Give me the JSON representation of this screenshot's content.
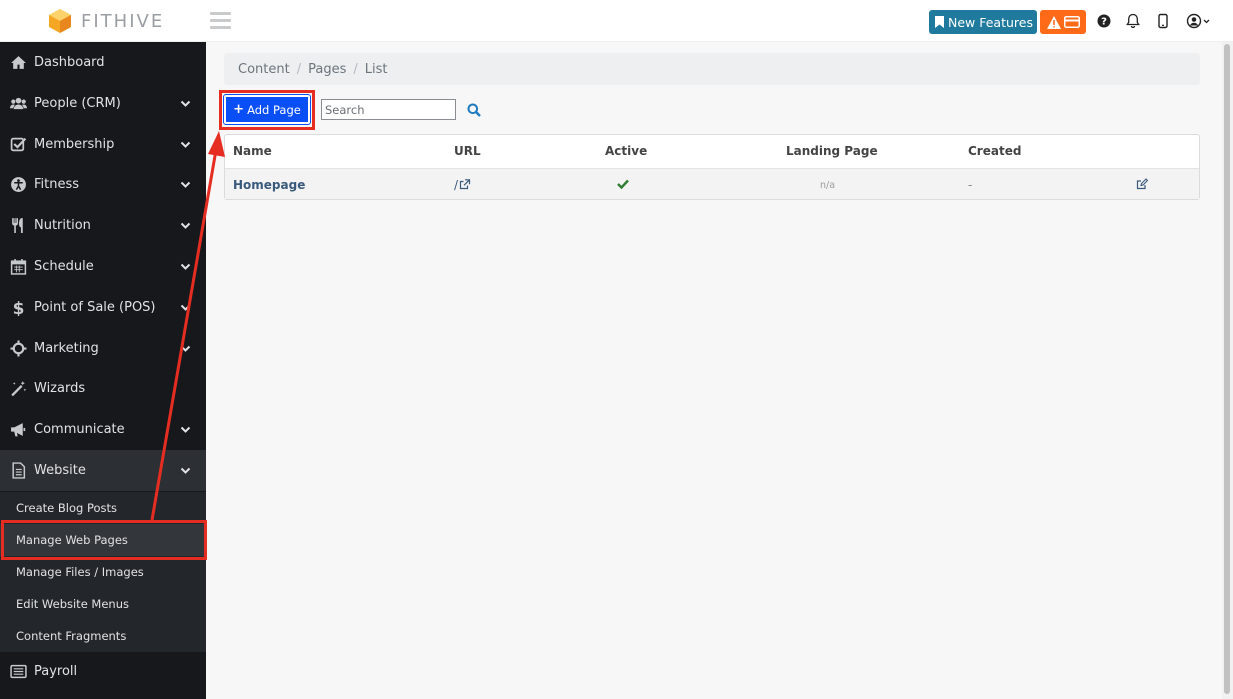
{
  "app": {
    "brand": "FITHIVE",
    "brand_accent": "#f5a623"
  },
  "topbar": {
    "new_features_label": "New Features",
    "new_features_color": "#1f7a9e",
    "warning_color": "#ff6a19",
    "icons": [
      "bookmark-icon",
      "warning-icon",
      "credit-card-icon",
      "help-icon",
      "bell-icon",
      "mobile-icon",
      "user-icon"
    ]
  },
  "sidebar": {
    "items": [
      {
        "label": "Dashboard",
        "icon": "home-icon"
      },
      {
        "label": "People (CRM)",
        "icon": "users-icon"
      },
      {
        "label": "Membership",
        "icon": "check-square-icon"
      },
      {
        "label": "Fitness",
        "icon": "accessibility-icon"
      },
      {
        "label": "Nutrition",
        "icon": "utensils-icon"
      },
      {
        "label": "Schedule",
        "icon": "calendar-icon"
      },
      {
        "label": "Point of Sale (POS)",
        "icon": "dollar-icon"
      },
      {
        "label": "Marketing",
        "icon": "crosshair-icon"
      },
      {
        "label": "Wizards",
        "icon": "magic-wand-icon"
      },
      {
        "label": "Communicate",
        "icon": "megaphone-icon"
      },
      {
        "label": "Website",
        "icon": "file-icon"
      },
      {
        "label": "Payroll",
        "icon": "list-icon"
      }
    ],
    "website_submenu": [
      {
        "label": "Create Blog Posts"
      },
      {
        "label": "Manage Web Pages"
      },
      {
        "label": "Manage Files / Images"
      },
      {
        "label": "Edit Website Menus"
      },
      {
        "label": "Content Fragments"
      }
    ]
  },
  "breadcrumb": {
    "items": [
      "Content",
      "Pages",
      "List"
    ]
  },
  "toolbar": {
    "add_label": "Add Page",
    "search_placeholder": "Search"
  },
  "table": {
    "headers": [
      "Name",
      "URL",
      "Active",
      "Landing Page",
      "Created"
    ],
    "rows": [
      {
        "name": "Homepage",
        "url": "/",
        "active": true,
        "landing_page": "n/a",
        "created": "-"
      }
    ]
  },
  "annotation_color": "#e52d22"
}
